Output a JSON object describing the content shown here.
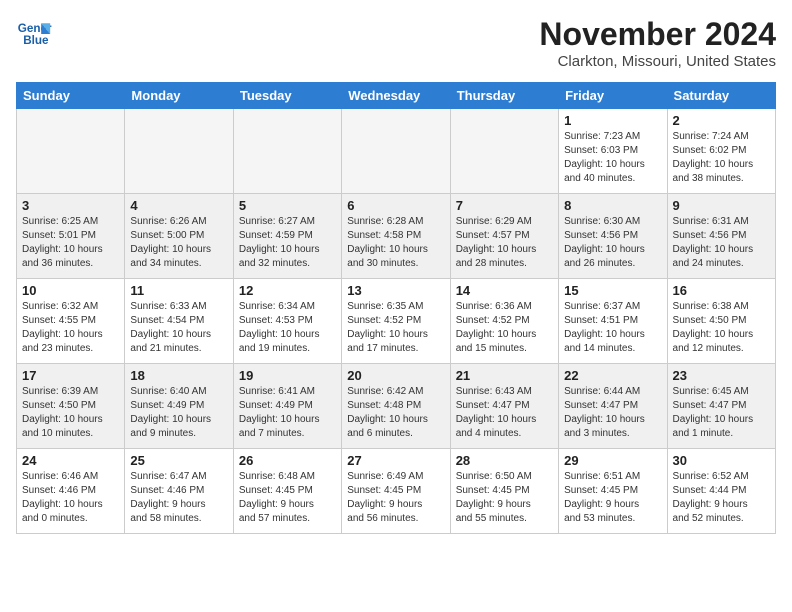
{
  "logo": {
    "line1": "General",
    "line2": "Blue"
  },
  "title": "November 2024",
  "location": "Clarkton, Missouri, United States",
  "days_of_week": [
    "Sunday",
    "Monday",
    "Tuesday",
    "Wednesday",
    "Thursday",
    "Friday",
    "Saturday"
  ],
  "weeks": [
    [
      {
        "day": "",
        "info": "",
        "empty": true
      },
      {
        "day": "",
        "info": "",
        "empty": true
      },
      {
        "day": "",
        "info": "",
        "empty": true
      },
      {
        "day": "",
        "info": "",
        "empty": true
      },
      {
        "day": "",
        "info": "",
        "empty": true
      },
      {
        "day": "1",
        "info": "Sunrise: 7:23 AM\nSunset: 6:03 PM\nDaylight: 10 hours\nand 40 minutes.",
        "empty": false
      },
      {
        "day": "2",
        "info": "Sunrise: 7:24 AM\nSunset: 6:02 PM\nDaylight: 10 hours\nand 38 minutes.",
        "empty": false
      }
    ],
    [
      {
        "day": "3",
        "info": "Sunrise: 6:25 AM\nSunset: 5:01 PM\nDaylight: 10 hours\nand 36 minutes.",
        "empty": false
      },
      {
        "day": "4",
        "info": "Sunrise: 6:26 AM\nSunset: 5:00 PM\nDaylight: 10 hours\nand 34 minutes.",
        "empty": false
      },
      {
        "day": "5",
        "info": "Sunrise: 6:27 AM\nSunset: 4:59 PM\nDaylight: 10 hours\nand 32 minutes.",
        "empty": false
      },
      {
        "day": "6",
        "info": "Sunrise: 6:28 AM\nSunset: 4:58 PM\nDaylight: 10 hours\nand 30 minutes.",
        "empty": false
      },
      {
        "day": "7",
        "info": "Sunrise: 6:29 AM\nSunset: 4:57 PM\nDaylight: 10 hours\nand 28 minutes.",
        "empty": false
      },
      {
        "day": "8",
        "info": "Sunrise: 6:30 AM\nSunset: 4:56 PM\nDaylight: 10 hours\nand 26 minutes.",
        "empty": false
      },
      {
        "day": "9",
        "info": "Sunrise: 6:31 AM\nSunset: 4:56 PM\nDaylight: 10 hours\nand 24 minutes.",
        "empty": false
      }
    ],
    [
      {
        "day": "10",
        "info": "Sunrise: 6:32 AM\nSunset: 4:55 PM\nDaylight: 10 hours\nand 23 minutes.",
        "empty": false
      },
      {
        "day": "11",
        "info": "Sunrise: 6:33 AM\nSunset: 4:54 PM\nDaylight: 10 hours\nand 21 minutes.",
        "empty": false
      },
      {
        "day": "12",
        "info": "Sunrise: 6:34 AM\nSunset: 4:53 PM\nDaylight: 10 hours\nand 19 minutes.",
        "empty": false
      },
      {
        "day": "13",
        "info": "Sunrise: 6:35 AM\nSunset: 4:52 PM\nDaylight: 10 hours\nand 17 minutes.",
        "empty": false
      },
      {
        "day": "14",
        "info": "Sunrise: 6:36 AM\nSunset: 4:52 PM\nDaylight: 10 hours\nand 15 minutes.",
        "empty": false
      },
      {
        "day": "15",
        "info": "Sunrise: 6:37 AM\nSunset: 4:51 PM\nDaylight: 10 hours\nand 14 minutes.",
        "empty": false
      },
      {
        "day": "16",
        "info": "Sunrise: 6:38 AM\nSunset: 4:50 PM\nDaylight: 10 hours\nand 12 minutes.",
        "empty": false
      }
    ],
    [
      {
        "day": "17",
        "info": "Sunrise: 6:39 AM\nSunset: 4:50 PM\nDaylight: 10 hours\nand 10 minutes.",
        "empty": false
      },
      {
        "day": "18",
        "info": "Sunrise: 6:40 AM\nSunset: 4:49 PM\nDaylight: 10 hours\nand 9 minutes.",
        "empty": false
      },
      {
        "day": "19",
        "info": "Sunrise: 6:41 AM\nSunset: 4:49 PM\nDaylight: 10 hours\nand 7 minutes.",
        "empty": false
      },
      {
        "day": "20",
        "info": "Sunrise: 6:42 AM\nSunset: 4:48 PM\nDaylight: 10 hours\nand 6 minutes.",
        "empty": false
      },
      {
        "day": "21",
        "info": "Sunrise: 6:43 AM\nSunset: 4:47 PM\nDaylight: 10 hours\nand 4 minutes.",
        "empty": false
      },
      {
        "day": "22",
        "info": "Sunrise: 6:44 AM\nSunset: 4:47 PM\nDaylight: 10 hours\nand 3 minutes.",
        "empty": false
      },
      {
        "day": "23",
        "info": "Sunrise: 6:45 AM\nSunset: 4:47 PM\nDaylight: 10 hours\nand 1 minute.",
        "empty": false
      }
    ],
    [
      {
        "day": "24",
        "info": "Sunrise: 6:46 AM\nSunset: 4:46 PM\nDaylight: 10 hours\nand 0 minutes.",
        "empty": false
      },
      {
        "day": "25",
        "info": "Sunrise: 6:47 AM\nSunset: 4:46 PM\nDaylight: 9 hours\nand 58 minutes.",
        "empty": false
      },
      {
        "day": "26",
        "info": "Sunrise: 6:48 AM\nSunset: 4:45 PM\nDaylight: 9 hours\nand 57 minutes.",
        "empty": false
      },
      {
        "day": "27",
        "info": "Sunrise: 6:49 AM\nSunset: 4:45 PM\nDaylight: 9 hours\nand 56 minutes.",
        "empty": false
      },
      {
        "day": "28",
        "info": "Sunrise: 6:50 AM\nSunset: 4:45 PM\nDaylight: 9 hours\nand 55 minutes.",
        "empty": false
      },
      {
        "day": "29",
        "info": "Sunrise: 6:51 AM\nSunset: 4:45 PM\nDaylight: 9 hours\nand 53 minutes.",
        "empty": false
      },
      {
        "day": "30",
        "info": "Sunrise: 6:52 AM\nSunset: 4:44 PM\nDaylight: 9 hours\nand 52 minutes.",
        "empty": false
      }
    ]
  ]
}
